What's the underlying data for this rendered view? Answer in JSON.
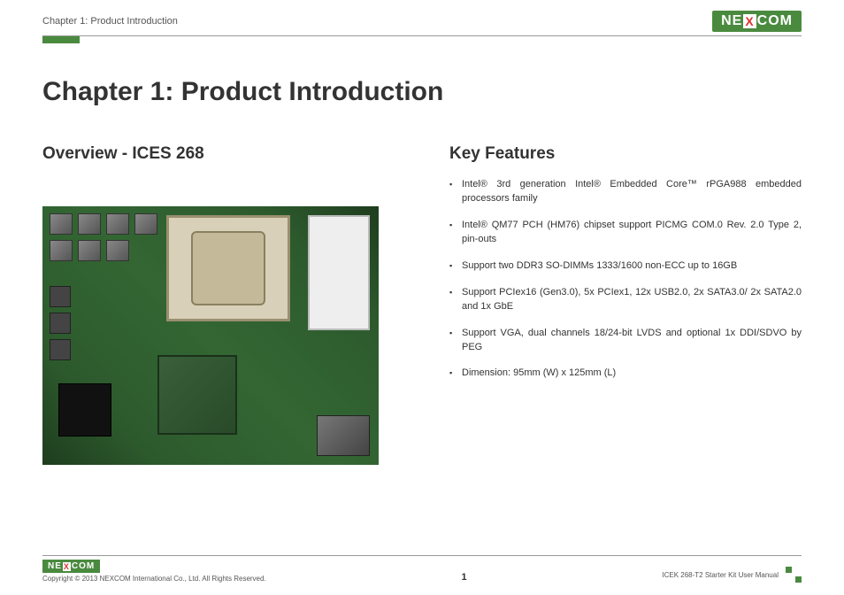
{
  "header": {
    "breadcrumb": "Chapter 1: Product Introduction",
    "logo_parts": {
      "pre": "NE",
      "x": "X",
      "post": "COM"
    }
  },
  "chapter_title": "Chapter 1: Product Introduction",
  "overview": {
    "title": "Overview - ICES 268"
  },
  "key_features": {
    "title": "Key Features",
    "items": [
      "Intel® 3rd generation Intel® Embedded Core™ rPGA988 embedded processors family",
      "Intel® QM77 PCH (HM76) chipset support PICMG COM.0 Rev. 2.0 Type 2, pin-outs",
      "Support two DDR3 SO-DIMMs 1333/1600 non-ECC up to 16GB",
      "Support PCIex16 (Gen3.0), 5x PCIex1, 12x USB2.0, 2x SATA3.0/ 2x SATA2.0 and 1x GbE",
      "Support VGA, dual channels 18/24-bit LVDS and optional 1x DDI/SDVO by PEG",
      "Dimension: 95mm (W) x 125mm (L)"
    ]
  },
  "footer": {
    "copyright": "Copyright © 2013 NEXCOM International Co., Ltd. All Rights Reserved.",
    "page_number": "1",
    "manual_name": "ICEK 268-T2 Starter Kit User Manual",
    "logo_parts": {
      "pre": "NE",
      "x": "X",
      "post": "COM"
    }
  }
}
